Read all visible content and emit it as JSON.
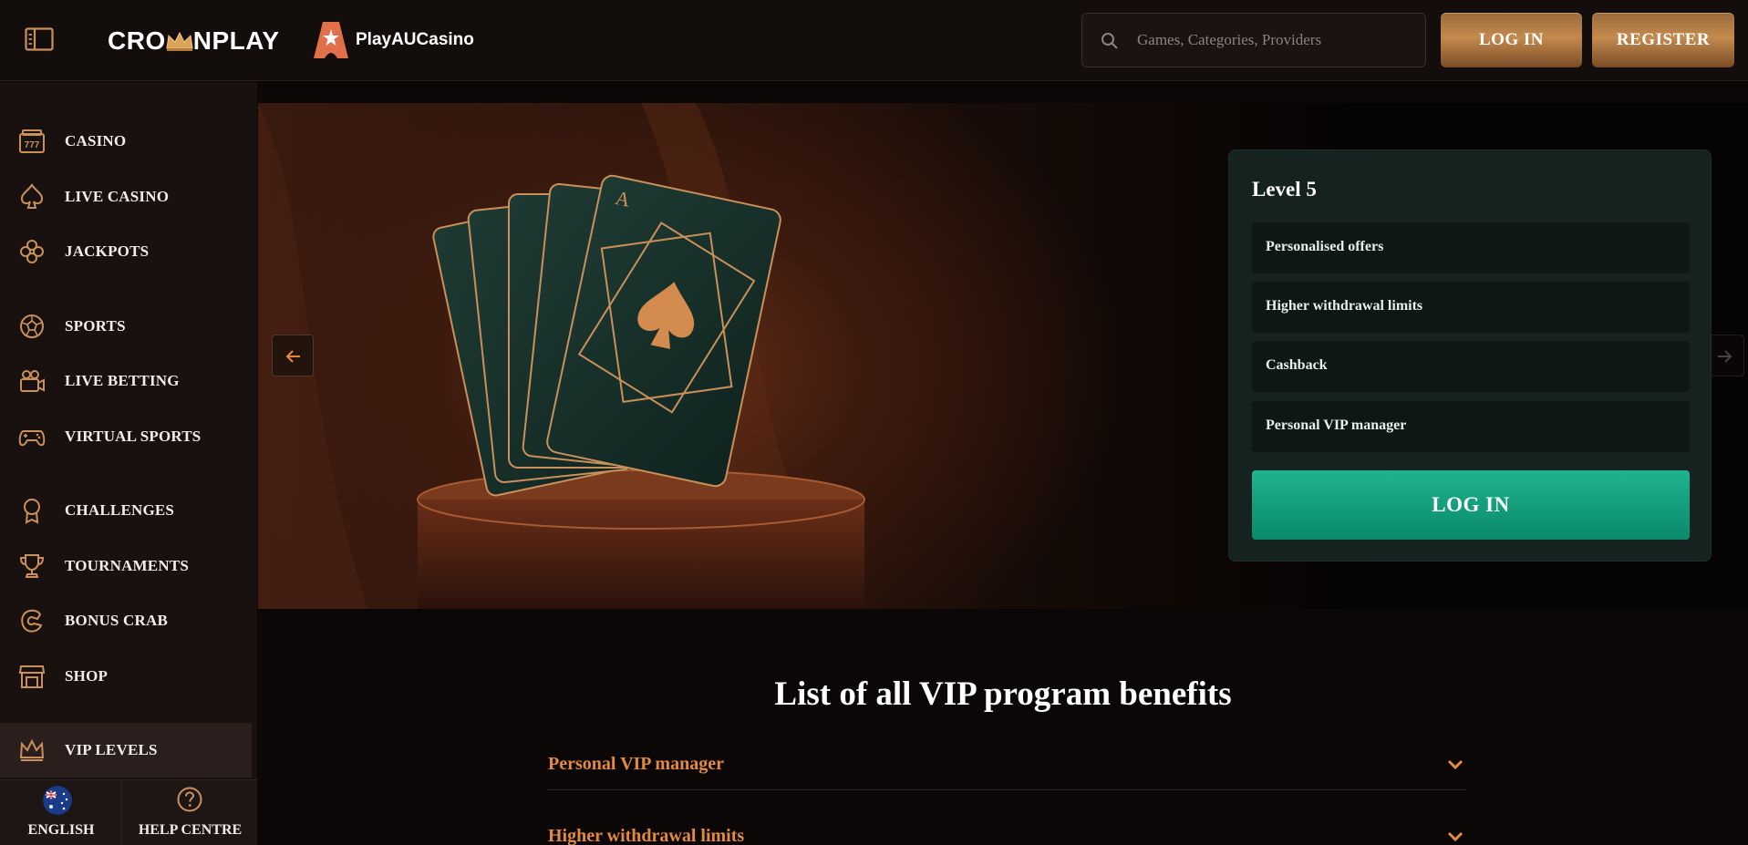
{
  "header": {
    "logo_text_left": "CRO",
    "logo_text_right": "NPLAY",
    "partner_name": "PlayAUCasino",
    "search_placeholder": "Games, Categories, Providers",
    "login_label": "LOG IN",
    "register_label": "REGISTER"
  },
  "sidebar": {
    "items": [
      {
        "label": "CASINO",
        "icon": "slot-machine-icon"
      },
      {
        "label": "LIVE CASINO",
        "icon": "spade-icon"
      },
      {
        "label": "JACKPOTS",
        "icon": "clover-icon"
      },
      {
        "label": "SPORTS",
        "icon": "ball-icon"
      },
      {
        "label": "LIVE BETTING",
        "icon": "camera-icon"
      },
      {
        "label": "VIRTUAL SPORTS",
        "icon": "gamepad-icon"
      },
      {
        "label": "CHALLENGES",
        "icon": "medal-icon"
      },
      {
        "label": "TOURNAMENTS",
        "icon": "trophy-icon"
      },
      {
        "label": "BONUS CRAB",
        "icon": "crab-claw-icon"
      },
      {
        "label": "SHOP",
        "icon": "shop-icon"
      },
      {
        "label": "VIP LEVELS",
        "icon": "crown-icon",
        "active": true
      }
    ],
    "language_label": "ENGLISH",
    "help_label": "HELP CENTRE"
  },
  "hero": {
    "level_title": "Level 5",
    "benefits": [
      "Personalised offers",
      "Higher withdrawal limits",
      "Cashback",
      "Personal VIP manager"
    ],
    "login_label": "LOG IN"
  },
  "vip_section": {
    "title": "List of all VIP program benefits",
    "accordion": [
      "Personal VIP manager",
      "Higher withdrawal limits"
    ]
  },
  "colors": {
    "accent_gold": "#c48a4e",
    "accent_orange": "#e38a3e",
    "accent_teal": "#1fb38f",
    "card_bg": "#16221f",
    "sidebar_bg": "#181110"
  }
}
